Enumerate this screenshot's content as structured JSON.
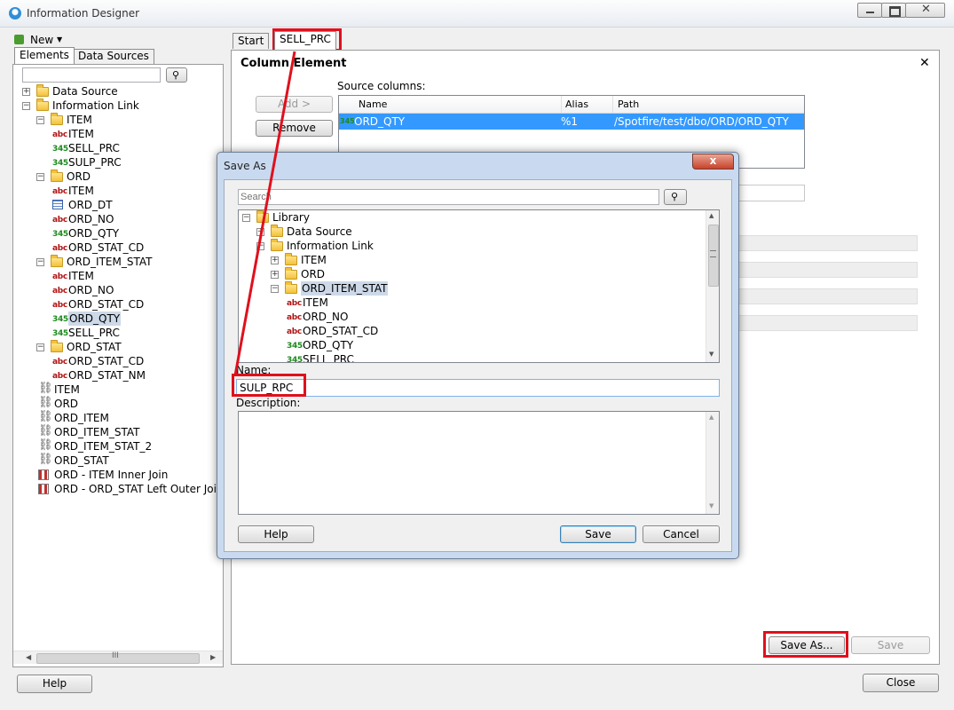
{
  "window": {
    "title": "Information Designer"
  },
  "left": {
    "new_label": "New",
    "tabs": [
      "Elements",
      "Data Sources"
    ],
    "search_placeholder": "",
    "tree": [
      {
        "label": "Data Source",
        "icon": "folder",
        "indent": 0,
        "exp": "+"
      },
      {
        "label": "Information Link",
        "icon": "folder",
        "indent": 0,
        "exp": "-"
      },
      {
        "label": "ITEM",
        "icon": "folder",
        "indent": 1,
        "exp": "-"
      },
      {
        "label": "ITEM",
        "icon": "abc",
        "indent": 2
      },
      {
        "label": "SELL_PRC",
        "icon": "345",
        "indent": 2
      },
      {
        "label": "SULP_PRC",
        "icon": "345",
        "indent": 2
      },
      {
        "label": "ORD",
        "icon": "folder",
        "indent": 1,
        "exp": "-"
      },
      {
        "label": "ITEM",
        "icon": "abc",
        "indent": 2
      },
      {
        "label": "ORD_DT",
        "icon": "date",
        "indent": 2
      },
      {
        "label": "ORD_NO",
        "icon": "abc",
        "indent": 2
      },
      {
        "label": "ORD_QTY",
        "icon": "345",
        "indent": 2
      },
      {
        "label": "ORD_STAT_CD",
        "icon": "abc",
        "indent": 2
      },
      {
        "label": "ORD_ITEM_STAT",
        "icon": "folder",
        "indent": 1,
        "exp": "-"
      },
      {
        "label": "ITEM",
        "icon": "abc",
        "indent": 2
      },
      {
        "label": "ORD_NO",
        "icon": "abc",
        "indent": 2
      },
      {
        "label": "ORD_STAT_CD",
        "icon": "abc",
        "indent": 2
      },
      {
        "label": "ORD_QTY",
        "icon": "345",
        "indent": 2,
        "selected": true
      },
      {
        "label": "SELL_PRC",
        "icon": "345",
        "indent": 2
      },
      {
        "label": "ORD_STAT",
        "icon": "folder",
        "indent": 1,
        "exp": "-"
      },
      {
        "label": "ORD_STAT_CD",
        "icon": "abc",
        "indent": 2
      },
      {
        "label": "ORD_STAT_NM",
        "icon": "abc",
        "indent": 2
      },
      {
        "label": "ITEM",
        "icon": "link",
        "indent": 1
      },
      {
        "label": "ORD",
        "icon": "link",
        "indent": 1
      },
      {
        "label": "ORD_ITEM",
        "icon": "link",
        "indent": 1
      },
      {
        "label": "ORD_ITEM_STAT",
        "icon": "link",
        "indent": 1
      },
      {
        "label": "ORD_ITEM_STAT_2",
        "icon": "link",
        "indent": 1
      },
      {
        "label": "ORD_STAT",
        "icon": "link",
        "indent": 1
      },
      {
        "label": "ORD - ITEM  Inner Join",
        "icon": "join",
        "indent": 1
      },
      {
        "label": "ORD - ORD_STAT  Left Outer Join",
        "icon": "join",
        "indent": 1
      }
    ],
    "scroll_grip": "III"
  },
  "main": {
    "tabs": [
      "Start",
      "SELL_PRC"
    ],
    "heading": "Column Element",
    "close_glyph": "✕",
    "add_label": "Add >",
    "remove_label": "Remove",
    "source_columns_label": "Source columns:",
    "columns": [
      "Name",
      "Alias",
      "Path"
    ],
    "rows": [
      {
        "icon": "345",
        "name": "ORD_QTY",
        "alias": "%1",
        "path": "/Spotfire/test/dbo/ORD/ORD_QTY"
      }
    ],
    "save_as_label": "Save As...",
    "save_label": "Save"
  },
  "dialog": {
    "title": "Save As",
    "close_glyph": "x",
    "search_placeholder": "Search",
    "tree": [
      {
        "label": "Library",
        "icon": "folder",
        "indent": 0,
        "exp": "-"
      },
      {
        "label": "Data Source",
        "icon": "folder",
        "indent": 1,
        "exp": "+"
      },
      {
        "label": "Information Link",
        "icon": "folder",
        "indent": 1,
        "exp": "-"
      },
      {
        "label": "ITEM",
        "icon": "folder",
        "indent": 2,
        "exp": "+"
      },
      {
        "label": "ORD",
        "icon": "folder",
        "indent": 2,
        "exp": "+"
      },
      {
        "label": "ORD_ITEM_STAT",
        "icon": "folder",
        "indent": 2,
        "exp": "-",
        "selected": true
      },
      {
        "label": "ITEM",
        "icon": "abc",
        "indent": 3
      },
      {
        "label": "ORD_NO",
        "icon": "abc",
        "indent": 3
      },
      {
        "label": "ORD_STAT_CD",
        "icon": "abc",
        "indent": 3
      },
      {
        "label": "ORD_QTY",
        "icon": "345",
        "indent": 3
      },
      {
        "label": "SELL_PRC",
        "icon": "345",
        "indent": 3
      }
    ],
    "name_label": "Name:",
    "name_value": "SULP_RPC",
    "description_label": "Description:",
    "help_label": "Help",
    "save_label": "Save",
    "cancel_label": "Cancel"
  },
  "footer": {
    "help_label": "Help",
    "close_label": "Close"
  }
}
